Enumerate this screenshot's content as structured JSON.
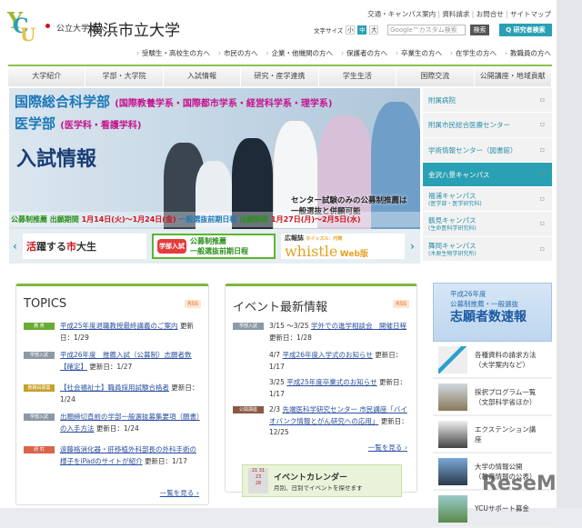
{
  "header": {
    "org": "公立大学法人",
    "name": "横浜市立大学",
    "logo_text": "YCU",
    "top_links": [
      "交通・キャンパス案内",
      "資料請求",
      "お問合せ",
      "サイトマップ"
    ],
    "font_size_label": "文字サイズ",
    "font_sizes": [
      "小",
      "中",
      "大"
    ],
    "search_placeholder": "Google™カスタム検索",
    "search_button": "検索",
    "researcher_search": "Q 研究者検索"
  },
  "audience_nav": [
    "受験生・高校生の方へ",
    "市民の方へ",
    "企業・他機関の方へ",
    "保護者の方へ",
    "卒業生の方へ",
    "在学生の方へ",
    "教職員の方へ"
  ],
  "global_nav": [
    "大学紹介",
    "学部・大学院",
    "入試情報",
    "研究・産学連携",
    "学生生活",
    "国際交流",
    "公開講座・地域貢献"
  ],
  "hero": {
    "line1": "国際総合科学部",
    "line1_sub": "(国際教養学系・国際都市学系・経営科学系・理学系)",
    "line2": "医学部",
    "line2_sub": "(医学科・看護学科)",
    "title": "入試情報",
    "note1": "センター試験のみの公募制推薦は",
    "note2": "一般選抜と併願可能",
    "d1": "公募制推薦",
    "d2": "出願期間",
    "d3": "1月14日(火)〜1月24日(金)",
    "d4": "一般選抜前期日程",
    "d5": "出願期間",
    "d6": "1月27日(月)〜2月5日(水)"
  },
  "banners": {
    "b1a": "活",
    "b1b": "躍する",
    "b1c": "市",
    "b1d": "大生",
    "b2_tag": "学部入試",
    "b2_l1": "公募制推薦",
    "b2_l2": "一般選抜前期日程",
    "b3_a": "広報誌",
    "b3_b": "ホイッスル：円筒",
    "b3_c": "whistle",
    "b3_d": "Web版"
  },
  "sidebar": [
    {
      "label": "附属病院"
    },
    {
      "label": "附属市民総合医療センター"
    },
    {
      "label": "学術情報センター（図書館）"
    },
    {
      "label": "金沢八景キャンパス"
    },
    {
      "label": "福浦キャンパス",
      "sub": "(医学部・医学研究科)"
    },
    {
      "label": "鶴見キャンパス",
      "sub": "(生命医科学研究科)"
    },
    {
      "label": "舞岡キャンパス",
      "sub": "(木原生物学研究所)"
    }
  ],
  "topics": {
    "title": "TOPICS",
    "rss": "RSS",
    "more": "一覧を見る",
    "items": [
      {
        "tag": "教 育",
        "color": "#6aab35",
        "link": "平成25年度退職教授最終講義のご案内",
        "date": "更新日：1/29"
      },
      {
        "tag": "学部入試",
        "color": "#8c9aa6",
        "link": "平成26年度　推薦入試（公募制）志願者数【確定】",
        "date": "更新日：1/27"
      },
      {
        "tag": "教職員募集",
        "color": "#c7a02a",
        "link": "【社会福祉士】職員採用試験合格者",
        "date": "更新日：1/24"
      },
      {
        "tag": "学部入試",
        "color": "#8c9aa6",
        "link": "出願締切直前の学部一般選抜募集要項（願書）の入手方法",
        "date": "更新日：1/24"
      },
      {
        "tag": "研 究",
        "color": "#d9654a",
        "link": "遠藤格消化器・肝移植外科部長の外科手術の様子をiPadのサイトが紹介",
        "date": "更新日：1/17"
      }
    ]
  },
  "events": {
    "title": "イベント最新情報",
    "rss": "RSS",
    "more": "一覧を見る",
    "items": [
      {
        "tag": "学部入試",
        "color": "#8c9aa6",
        "pre": "3/15 〜3/25",
        "link": "学外での進学相談会　開催日程",
        "date": "更新日：1/28"
      },
      {
        "tag": "",
        "pre": "4/7",
        "link": "平成26年度入学式のお知らせ",
        "date": "更新日：1/17"
      },
      {
        "tag": "",
        "pre": "3/25",
        "link": "平成25年度卒業式のお知らせ",
        "date": "更新日：1/17"
      },
      {
        "tag": "公開講座",
        "color": "#8a5a44",
        "pre": "2/3",
        "link": "先端医科学研究センター 市民講座「バイオバンク情報とがん研究への応用」",
        "date": "更新日：12/25"
      }
    ],
    "calendar_title": "イベントカレンダー",
    "calendar_sub": "月別、日別でイベントを探せます"
  },
  "right": {
    "speed_l1": "平成26年度",
    "speed_l2": "公募制推薦・一般選抜",
    "speed_l3": "志願者数速報",
    "links": [
      {
        "l1": "各種資料の請求方法",
        "l2": "（大学案内など）"
      },
      {
        "l1": "採択プログラム一覧",
        "l2": "（文部科学省ほか）"
      },
      {
        "l1": "エクステンション講",
        "l2": "座"
      },
      {
        "l1": "大学の情報公開",
        "l2": "（教育情報の公表）"
      },
      {
        "l1": "YCUサポート募金",
        "l2": ""
      }
    ]
  },
  "watermark": "ReseMom"
}
